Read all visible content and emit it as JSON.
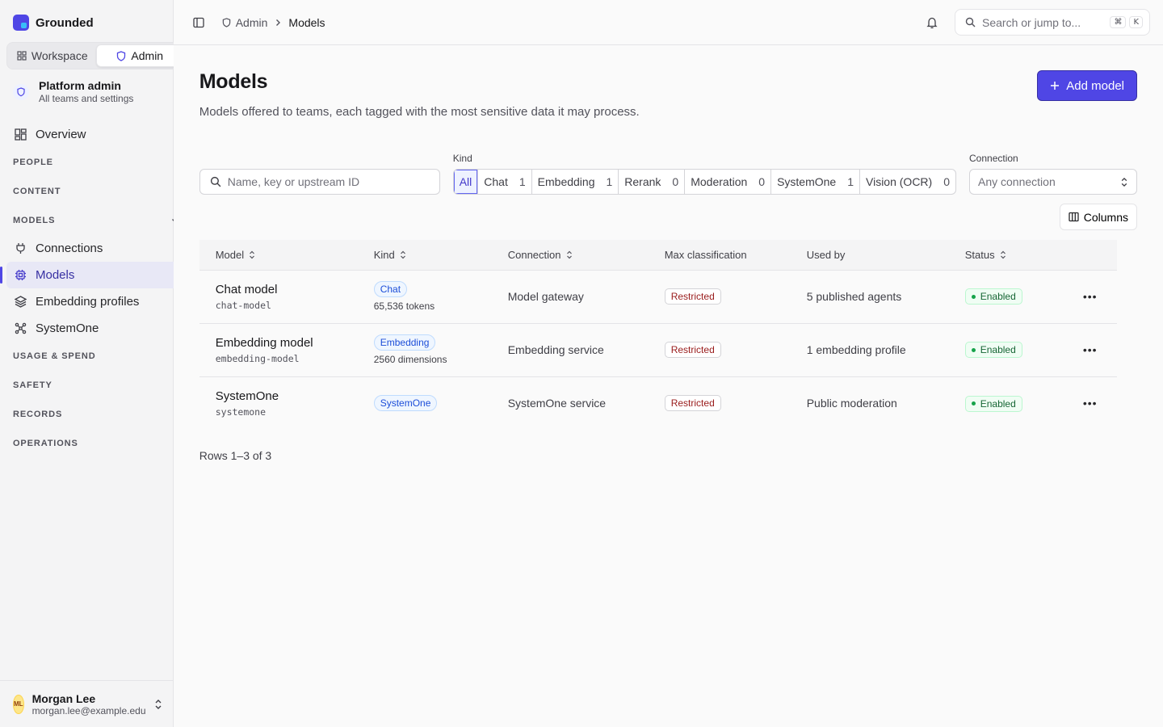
{
  "brand": {
    "name": "Grounded"
  },
  "mode_switch": {
    "workspace": "Workspace",
    "admin": "Admin"
  },
  "context": {
    "title": "Platform admin",
    "subtitle": "All teams and settings"
  },
  "nav": {
    "overview": "Overview",
    "people": "PEOPLE",
    "content": "CONTENT",
    "models": "MODELS",
    "connections": "Connections",
    "models_item": "Models",
    "embedding_profiles": "Embedding profiles",
    "systemone": "SystemOne",
    "usage_spend": "USAGE & SPEND",
    "safety": "SAFETY",
    "records": "RECORDS",
    "operations": "OPERATIONS"
  },
  "user": {
    "initials": "ML",
    "name": "Morgan Lee",
    "email": "morgan.lee@example.edu"
  },
  "breadcrumb": {
    "admin": "Admin",
    "current": "Models"
  },
  "top_search": {
    "placeholder": "Search or jump to...",
    "kbd1": "⌘",
    "kbd2": "K"
  },
  "page": {
    "title": "Models",
    "description": "Models offered to teams, each tagged with the most sensitive data it may process.",
    "add_button": "Add model"
  },
  "filters": {
    "search_placeholder": "Name, key or upstream ID",
    "kind_label": "Kind",
    "kinds": [
      {
        "label": "All",
        "count": ""
      },
      {
        "label": "Chat",
        "count": "1"
      },
      {
        "label": "Embedding",
        "count": "1"
      },
      {
        "label": "Rerank",
        "count": "0"
      },
      {
        "label": "Moderation",
        "count": "0"
      },
      {
        "label": "SystemOne",
        "count": "1"
      },
      {
        "label": "Vision (OCR)",
        "count": "0"
      }
    ],
    "connection_label": "Connection",
    "connection_value": "Any connection",
    "columns_button": "Columns"
  },
  "table": {
    "headers": {
      "model": "Model",
      "kind": "Kind",
      "connection": "Connection",
      "max_classification": "Max classification",
      "used_by": "Used by",
      "status": "Status"
    },
    "rows": [
      {
        "name": "Chat model",
        "key": "chat-model",
        "kind": "Chat",
        "kind_detail": "65,536 tokens",
        "connection": "Model gateway",
        "classification": "Restricted",
        "used_by": "5 published agents",
        "status": "Enabled"
      },
      {
        "name": "Embedding model",
        "key": "embedding-model",
        "kind": "Embedding",
        "kind_detail": "2560 dimensions",
        "connection": "Embedding service",
        "classification": "Restricted",
        "used_by": "1 embedding profile",
        "status": "Enabled"
      },
      {
        "name": "SystemOne",
        "key": "systemone",
        "kind": "SystemOne",
        "kind_detail": "",
        "connection": "SystemOne service",
        "classification": "Restricted",
        "used_by": "Public moderation",
        "status": "Enabled"
      }
    ],
    "footer": "Rows 1–3 of 3"
  },
  "colors": {
    "accent": "#4f46e5",
    "enabled": "#16a34a",
    "restricted": "#991b1b"
  }
}
